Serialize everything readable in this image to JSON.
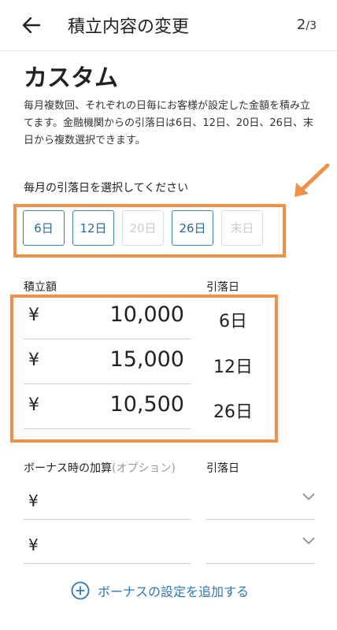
{
  "header": {
    "title": "積立内容の変更",
    "step_current": "2",
    "step_total": "/3"
  },
  "main": {
    "heading": "カスタム",
    "description": "毎月複数回、それぞれの日毎にお客様が設定した金額を積み立てます。金融機関からの引落日は6日、12日、20日、26日、末日から複数選択できます。",
    "select_label": "毎月の引落日を選択してください",
    "days": [
      {
        "label": "6日",
        "selected": true
      },
      {
        "label": "12日",
        "selected": true
      },
      {
        "label": "20日",
        "selected": false
      },
      {
        "label": "26日",
        "selected": true
      },
      {
        "label": "末日",
        "selected": false
      }
    ],
    "amount_label": "積立額",
    "date_label": "引落日",
    "currency": "¥",
    "rows": [
      {
        "amount": "10,000",
        "date": "6日"
      },
      {
        "amount": "15,000",
        "date": "12日"
      },
      {
        "amount": "10,500",
        "date": "26日"
      }
    ],
    "bonus_label": "ボーナス時の加算",
    "bonus_option": "(オプション)",
    "bonus_date_label": "引落日",
    "add_bonus": "ボーナスの設定を追加する"
  },
  "colors": {
    "accent": "#2a78b6",
    "highlight": "#f0914a"
  }
}
